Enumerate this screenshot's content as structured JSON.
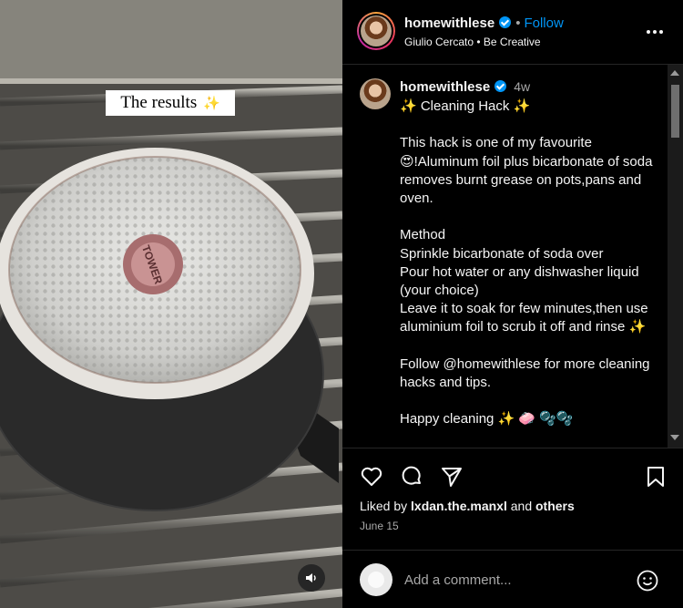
{
  "video": {
    "overlay_text": "The results",
    "overlay_emoji": "✨",
    "pot_brand": "TOWER"
  },
  "header": {
    "username": "homewithlese",
    "follow_label": "Follow",
    "separator": "•",
    "subtitle": "Giulio Cercato • Be Creative"
  },
  "caption": {
    "username": "homewithlese",
    "time_ago": "4w",
    "text": "✨ Cleaning Hack ✨\n\nThis hack is one of my favourite\n😍!Aluminum foil plus bicarbonate of soda removes burnt grease on pots,pans and oven.\n\nMethod\nSprinkle bicarbonate of soda over\nPour hot water or any dishwasher liquid (your choice)\nLeave it to soak for few minutes,then use aluminium foil to scrub it off and rinse ✨\n\nFollow @homewithlese for more cleaning hacks and tips.\n\nHappy cleaning ✨ 🧼 🫧🫧"
  },
  "engagement": {
    "liked_by_prefix": "Liked by",
    "liked_by_user": "lxdan.the.manxl",
    "liked_by_and": "and",
    "liked_by_others": "others",
    "date": "June 15"
  },
  "comment": {
    "placeholder": "Add a comment..."
  },
  "icons": {
    "like": "heart-icon",
    "comment": "comment-icon",
    "share": "send-icon",
    "save": "bookmark-icon",
    "more": "more-options-icon",
    "audio": "speaker-icon",
    "emoji": "emoji-icon"
  },
  "colors": {
    "accent_blue": "#0095f6",
    "background": "#000000",
    "muted_text": "#a8a8a8"
  }
}
